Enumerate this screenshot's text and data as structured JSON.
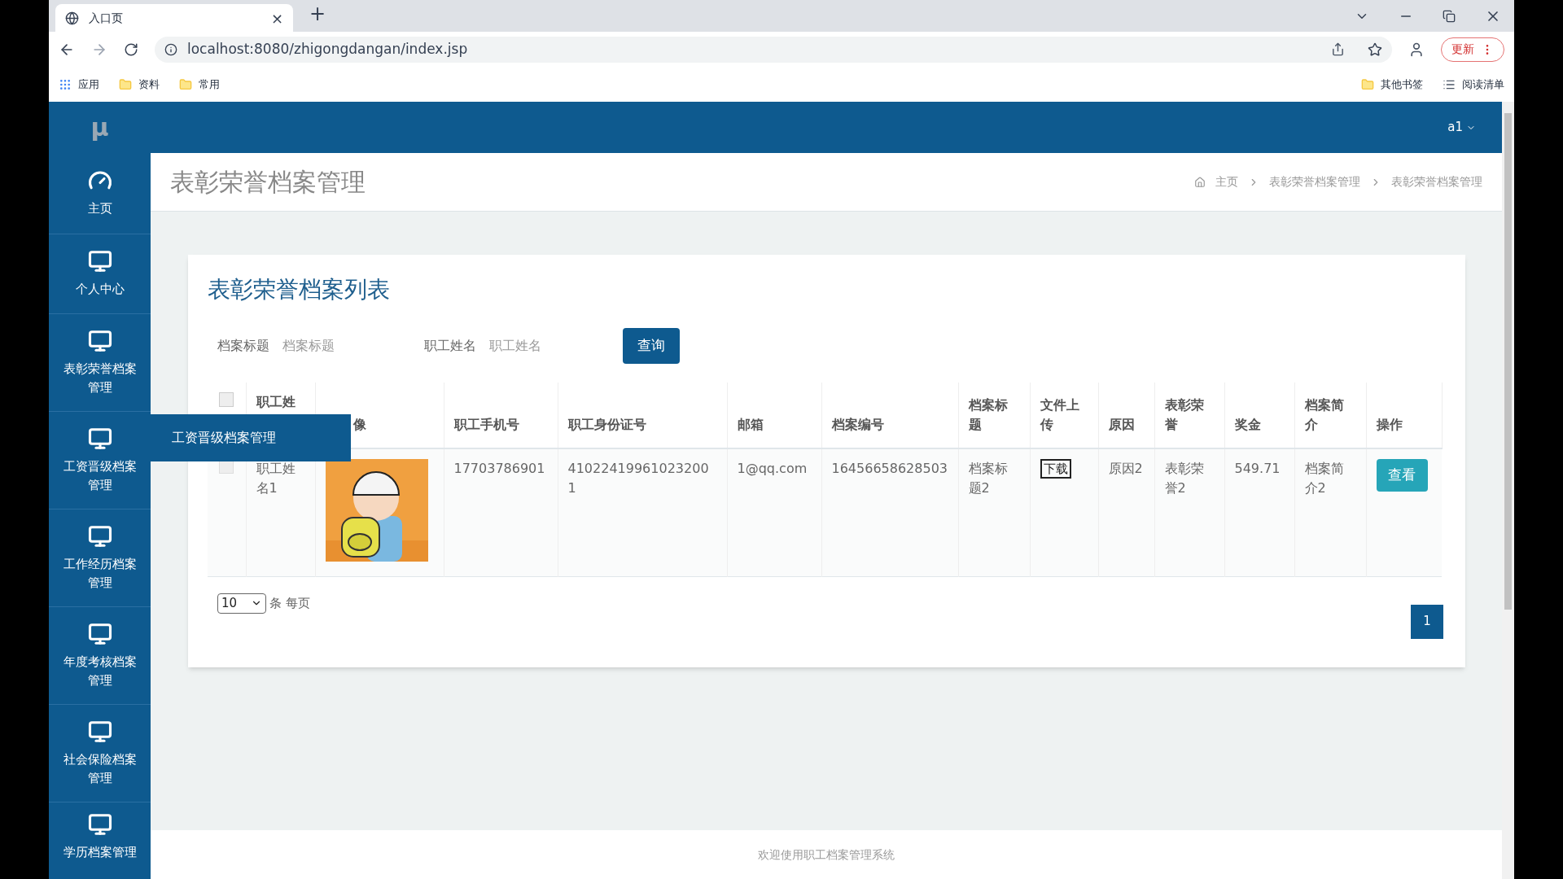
{
  "browser": {
    "tab": {
      "title": "入口页",
      "close": "×"
    },
    "new_tab": "+",
    "url": "localhost:8080/zhigongdangan/index.jsp",
    "update_button": "更新",
    "bookmarks": [
      {
        "kind": "apps",
        "label": "应用"
      },
      {
        "kind": "folder",
        "label": "资料"
      },
      {
        "kind": "folder",
        "label": "常用"
      }
    ],
    "bookmarks_right": [
      {
        "kind": "folder",
        "label": "其他书签"
      },
      {
        "kind": "reading",
        "label": "阅读清单"
      }
    ]
  },
  "app": {
    "logo": "μ",
    "user": "a1"
  },
  "sidebar": {
    "items": [
      {
        "kind": "dashboard",
        "label": "主页"
      },
      {
        "kind": "monitor",
        "label": "个人中心"
      },
      {
        "kind": "monitor",
        "label": "表彰荣誉档案管理"
      },
      {
        "kind": "monitor",
        "label": "工资晋级档案管理"
      },
      {
        "kind": "monitor",
        "label": "工作经历档案管理"
      },
      {
        "kind": "monitor",
        "label": "年度考核档案管理"
      },
      {
        "kind": "monitor",
        "label": "社会保险档案管理"
      },
      {
        "kind": "monitor",
        "label": "学历档案管理"
      }
    ],
    "flyout": "工资晋级档案管理"
  },
  "page": {
    "title": "表彰荣誉档案管理",
    "breadcrumb": [
      "主页",
      "表彰荣誉档案管理",
      "表彰荣誉档案管理"
    ]
  },
  "card": {
    "title": "表彰荣誉档案列表",
    "filters": [
      {
        "label": "档案标题",
        "placeholder": "档案标题"
      },
      {
        "label": "职工姓名",
        "placeholder": "职工姓名"
      }
    ],
    "search_button": "查询",
    "table": {
      "header_checked": false,
      "columns": [
        "职工姓",
        "像",
        "职工手机号",
        "职工身份证号",
        "邮箱",
        "档案编号",
        "档案标题",
        "文件上传",
        "原因",
        "表彰荣誉",
        "奖金",
        "档案简介",
        "操作"
      ],
      "rows": [
        {
          "checked": false,
          "name": "职工姓名1",
          "phone": "17703786901",
          "id_number": "410224199610232001",
          "email": "1@qq.com",
          "archive_no": "16456658628503",
          "archive_title": "档案标题2",
          "file": "下载",
          "reason": "原因2",
          "honor": "表彰荣誉2",
          "bonus": "549.71",
          "summary": "档案简介2",
          "action": "查看"
        }
      ]
    },
    "page_size": "10",
    "page_size_label": "条 每页",
    "pages": [
      {
        "label": "1",
        "selected": true
      }
    ]
  },
  "footer": "欢迎使用职工档案管理系统"
}
